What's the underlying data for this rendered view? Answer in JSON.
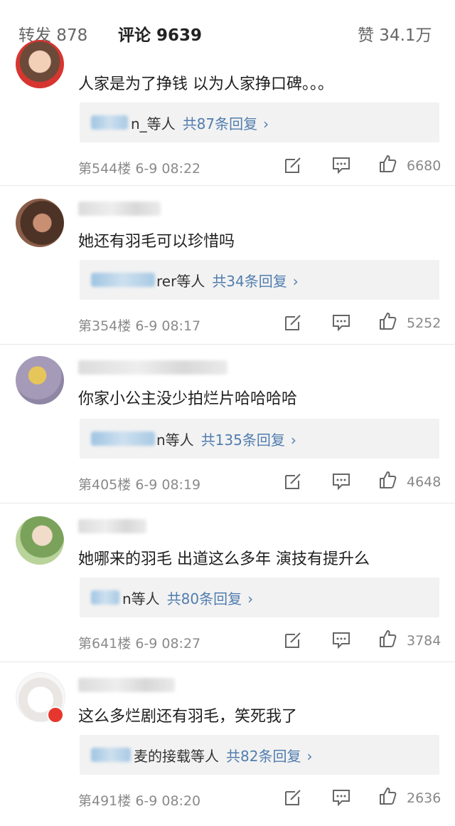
{
  "tabs": {
    "repost": "转发 878",
    "comments": "评论 9639",
    "likes": "赞 34.1万"
  },
  "colors": {
    "accent": "#ff8200",
    "link": "#507daf"
  },
  "comments": [
    {
      "text": "人家是为了挣钱 以为人家挣口碑。。。",
      "reply_names": "n_等人",
      "reply_count": "共87条回复",
      "floor": "第544楼",
      "time": "6-9 08:22",
      "likes": "6680"
    },
    {
      "text": "她还有羽毛可以珍惜吗",
      "reply_names": "rer等人",
      "reply_count": "共34条回复",
      "floor": "第354楼",
      "time": "6-9 08:17",
      "likes": "5252"
    },
    {
      "text": "你家小公主没少拍烂片哈哈哈哈",
      "reply_names": "n等人",
      "reply_count": "共135条回复",
      "floor": "第405楼",
      "time": "6-9 08:19",
      "likes": "4648"
    },
    {
      "text": "她哪来的羽毛 出道这么多年 演技有提升么",
      "reply_names": "n等人",
      "reply_count": "共80条回复",
      "floor": "第641楼",
      "time": "6-9 08:27",
      "likes": "3784"
    },
    {
      "text": "这么多烂剧还有羽毛，笑死我了",
      "reply_names": "麦的接载等人",
      "reply_count": "共82条回复",
      "floor": "第491楼",
      "time": "6-9 08:20",
      "likes": "2636"
    }
  ],
  "icons": {
    "chevron": "›",
    "repost": "repost-icon",
    "comment": "comment-icon",
    "like": "thumbs-up-icon"
  }
}
